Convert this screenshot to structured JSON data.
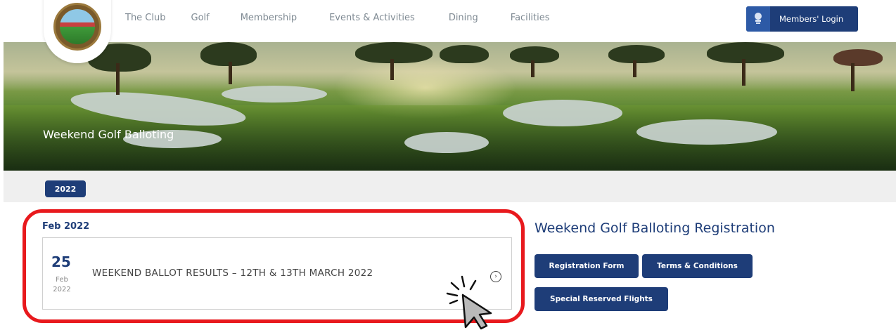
{
  "nav": {
    "items": [
      "The Club",
      "Golf",
      "Membership",
      "Events & Activities",
      "Dining",
      "Facilities"
    ],
    "login_label": "Members' Login"
  },
  "hero": {
    "title": "Weekend Golf Balloting"
  },
  "year_filter": {
    "selected": "2022"
  },
  "listing": {
    "month_heading": "Feb 2022",
    "items": [
      {
        "day": "25",
        "month": "Feb",
        "year": "2022",
        "title": "WEEKEND BALLOT RESULTS – 12TH & 13TH MARCH 2022"
      }
    ]
  },
  "registration": {
    "title": "Weekend Golf Balloting Registration",
    "buttons": [
      "Registration Form",
      "Terms & Conditions",
      "Special Reserved Flights"
    ]
  },
  "colors": {
    "brand_navy": "#1e3d78",
    "highlight_red": "#e8191d"
  },
  "icons": [
    "club-logo-icon",
    "members-login-icon",
    "arrow-circle-icon",
    "cursor-pointer-icon"
  ]
}
